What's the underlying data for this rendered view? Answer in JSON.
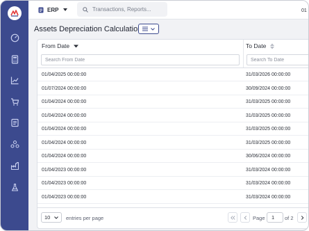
{
  "app": {
    "module_label": "ERP",
    "search_placeholder": "Transactions, Reports...",
    "user_initials": "01"
  },
  "sidebar": {
    "items": [
      {
        "icon": "dashboard-icon"
      },
      {
        "icon": "calculator-icon"
      },
      {
        "icon": "chart-line-icon"
      },
      {
        "icon": "cart-icon"
      },
      {
        "icon": "ledger-icon"
      },
      {
        "icon": "hierarchy-icon"
      },
      {
        "icon": "factory-icon"
      },
      {
        "icon": "lab-flask-icon"
      }
    ]
  },
  "page": {
    "title": "Assets Depreciation Calculation"
  },
  "table": {
    "columns": [
      {
        "label": "From Date",
        "filter_placeholder": "Search From Date",
        "sort": "desc"
      },
      {
        "label": "To Date",
        "filter_placeholder": "Search To Date",
        "sort": "none"
      }
    ],
    "rows": [
      [
        "01/04/2025 00:00:00",
        "31/03/2026 00:00:00"
      ],
      [
        "01/07/2024 00:00:00",
        "30/09/2024 00:00:00"
      ],
      [
        "01/04/2024 00:00:00",
        "31/03/2025 00:00:00"
      ],
      [
        "01/04/2024 00:00:00",
        "31/03/2025 00:00:00"
      ],
      [
        "01/04/2024 00:00:00",
        "31/03/2025 00:00:00"
      ],
      [
        "01/04/2024 00:00:00",
        "31/03/2025 00:00:00"
      ],
      [
        "01/04/2024 00:00:00",
        "30/06/2024 00:00:00"
      ],
      [
        "01/04/2023 00:00:00",
        "31/03/2024 00:00:00"
      ],
      [
        "01/04/2023 00:00:00",
        "31/03/2024 00:00:00"
      ],
      [
        "01/04/2023 00:00:00",
        "31/03/2024 00:00:00"
      ]
    ]
  },
  "pagination": {
    "per_page": "10",
    "per_page_label": "entries per page",
    "page_label": "Page",
    "current_page": "1",
    "of_label": "of 2"
  },
  "colors": {
    "sidebar": "#3c4a8e",
    "accent": "#3c4a8e",
    "background": "#f1f2f5"
  }
}
